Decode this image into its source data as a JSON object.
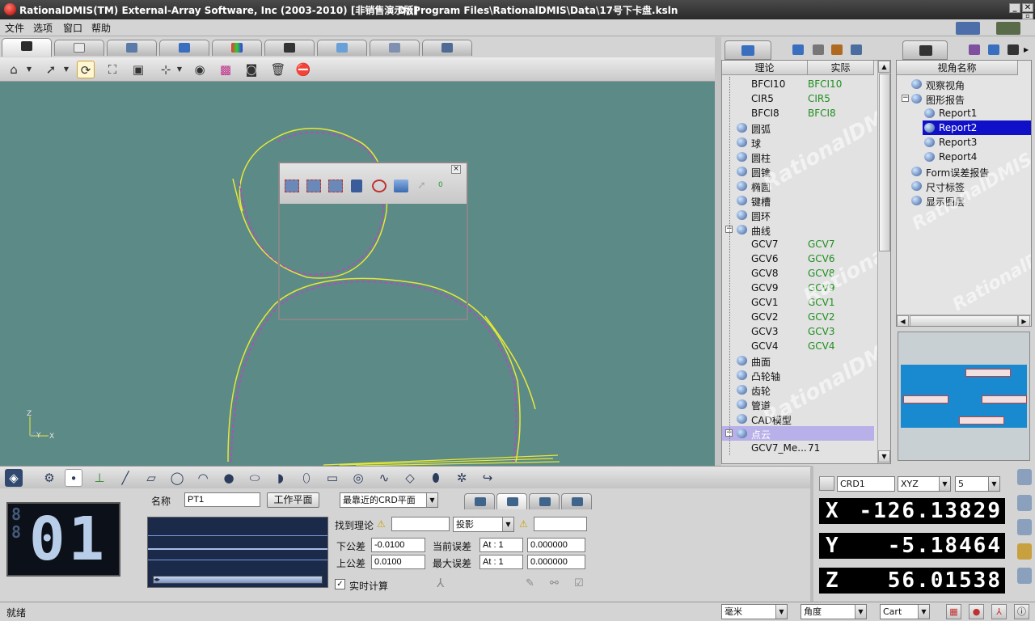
{
  "window": {
    "title": "RationalDMIS(TM) External-Array Software, Inc (2003-2010) [非销售演示版]",
    "path": "D:\\Program Files\\RationalDMIS\\Data\\17号下卡盘.ksln",
    "minimize": "_",
    "restore": "▫",
    "close": "✕"
  },
  "menu": [
    "文件",
    "选项",
    "窗口",
    "帮助"
  ],
  "floating_toolbar": {
    "count": "0"
  },
  "axes": {
    "x": "X",
    "y": "Y",
    "z": "Z"
  },
  "feature_tree": {
    "col_nominal": "理论",
    "col_actual": "实际",
    "rows": [
      {
        "name": "BFCI10",
        "actual": "BFCI10",
        "level": 2
      },
      {
        "name": "CIR5",
        "actual": "CIR5",
        "level": 2
      },
      {
        "name": "BFCI8",
        "actual": "BFCI8",
        "level": 2
      },
      {
        "name": "圆弧",
        "actual": "",
        "level": 1,
        "icon": "arc-icon"
      },
      {
        "name": "球",
        "actual": "",
        "level": 1,
        "icon": "sphere-icon"
      },
      {
        "name": "圆柱",
        "actual": "",
        "level": 1,
        "icon": "cylinder-icon"
      },
      {
        "name": "圆锥",
        "actual": "",
        "level": 1,
        "icon": "cone-icon"
      },
      {
        "name": "椭圆",
        "actual": "",
        "level": 1,
        "icon": "ellipse-icon"
      },
      {
        "name": "键槽",
        "actual": "",
        "level": 1,
        "icon": "slot-icon"
      },
      {
        "name": "圆环",
        "actual": "",
        "level": 1,
        "icon": "torus-icon"
      },
      {
        "name": "曲线",
        "actual": "",
        "level": 1,
        "icon": "curve-icon",
        "expanded": true
      },
      {
        "name": "GCV7",
        "actual": "GCV7",
        "level": 2
      },
      {
        "name": "GCV6",
        "actual": "GCV6",
        "level": 2
      },
      {
        "name": "GCV8",
        "actual": "GCV8",
        "level": 2
      },
      {
        "name": "GCV9",
        "actual": "GCV9",
        "level": 2
      },
      {
        "name": "GCV1",
        "actual": "GCV1",
        "level": 2
      },
      {
        "name": "GCV2",
        "actual": "GCV2",
        "level": 2
      },
      {
        "name": "GCV3",
        "actual": "GCV3",
        "level": 2
      },
      {
        "name": "GCV4",
        "actual": "GCV4",
        "level": 2
      },
      {
        "name": "曲面",
        "actual": "",
        "level": 1,
        "icon": "surface-icon"
      },
      {
        "name": "凸轮轴",
        "actual": "",
        "level": 1,
        "icon": "camshaft-icon"
      },
      {
        "name": "齿轮",
        "actual": "",
        "level": 1,
        "icon": "gear-icon"
      },
      {
        "name": "管道",
        "actual": "",
        "level": 1,
        "icon": "pipe-icon"
      },
      {
        "name": "CAD模型",
        "actual": "",
        "level": 1,
        "icon": "cad-icon"
      },
      {
        "name": "点云",
        "actual": "",
        "level": 1,
        "icon": "point-cloud-icon",
        "selected": true,
        "expanded": true
      },
      {
        "name": "GCV7_Me...",
        "actual": "71",
        "level": 2
      }
    ],
    "watermark": "RationalDMIS"
  },
  "view_tree": {
    "header": "视角名称",
    "rows": [
      {
        "name": "观察视角",
        "level": 1
      },
      {
        "name": "图形报告",
        "level": 1,
        "expanded": true
      },
      {
        "name": "Report1",
        "level": 2
      },
      {
        "name": "Report2",
        "level": 2,
        "selected": true
      },
      {
        "name": "Report3",
        "level": 2
      },
      {
        "name": "Report4",
        "level": 2
      },
      {
        "name": "Form误差报告",
        "level": 1
      },
      {
        "name": "尺寸标签",
        "level": 1
      },
      {
        "name": "显示图层",
        "level": 1
      }
    ]
  },
  "feature_panel": {
    "name_label": "名称",
    "name_value": "PT1",
    "workplane_button": "工作平面",
    "crd_plane": "最靠近的CRD平面",
    "led_count": "01",
    "find_nominal_label": "找到理论",
    "projection": "投影",
    "lower_tol_label": "下公差",
    "lower_tol": "-0.0100",
    "upper_tol_label": "上公差",
    "upper_tol": "0.0100",
    "current_err_label": "当前误差",
    "max_err_label": "最大误差",
    "current_at": "At : 1",
    "max_at": "At : 1",
    "current_err": "0.000000",
    "max_err": "0.000000",
    "realtime_label": "实时计算"
  },
  "coords": {
    "crd": "CRD1",
    "plane": "XYZ",
    "decimals": "5",
    "x_label": "X",
    "y_label": "Y",
    "z_label": "Z",
    "x": "-126.13829",
    "y": "-5.18464",
    "z": "56.01538"
  },
  "status": {
    "text": "就绪",
    "unit": "毫米",
    "angle": "角度",
    "coord_mode": "Cart"
  }
}
